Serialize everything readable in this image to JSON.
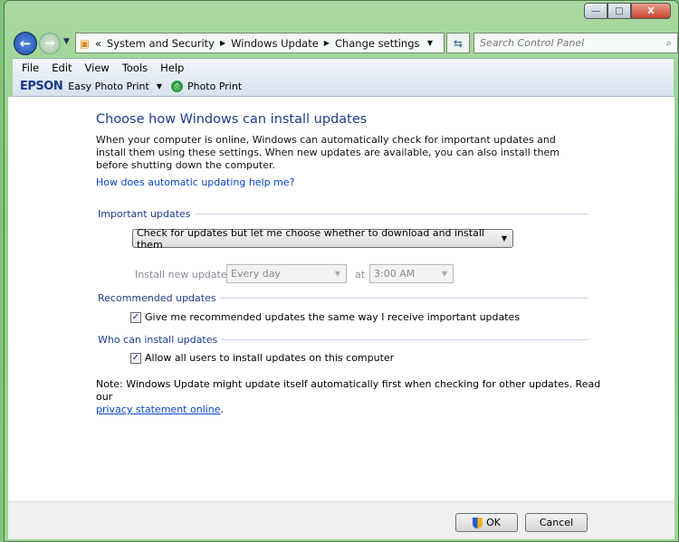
{
  "window": {
    "minimize": "—",
    "maximize": "□",
    "close": "X"
  },
  "nav": {
    "breadcrumb": [
      "System and Security",
      "Windows Update",
      "Change settings"
    ],
    "breadcrumb_prefix": "«",
    "search_placeholder": "Search Control Panel"
  },
  "menu": [
    "File",
    "Edit",
    "View",
    "Tools",
    "Help"
  ],
  "toolbar": {
    "brand": "EPSON",
    "easy_photo_print": "Easy Photo Print",
    "photo_print": "Photo Print"
  },
  "main": {
    "title": "Choose how Windows can install updates",
    "intro": "When your computer is online, Windows can automatically check for important updates and install them using these settings. When new updates are available, you can also install them before shutting down the computer.",
    "help_link": "How does automatic updating help me?",
    "important": {
      "heading": "Important updates",
      "selected": "Check for updates but let me choose whether to download and install them",
      "install_label": "Install new updates:",
      "day": "Every day",
      "at": "at",
      "time": "3:00 AM"
    },
    "recommended": {
      "heading": "Recommended updates",
      "checkbox": "Give me recommended updates the same way I receive important updates",
      "checked": true
    },
    "who": {
      "heading": "Who can install updates",
      "checkbox": "Allow all users to install updates on this computer",
      "checked": true
    },
    "note": "Note: Windows Update might update itself automatically first when checking for other updates.  Read our ",
    "privacy_link": "privacy statement online",
    "note_end": "."
  },
  "buttons": {
    "ok": "OK",
    "cancel": "Cancel"
  }
}
